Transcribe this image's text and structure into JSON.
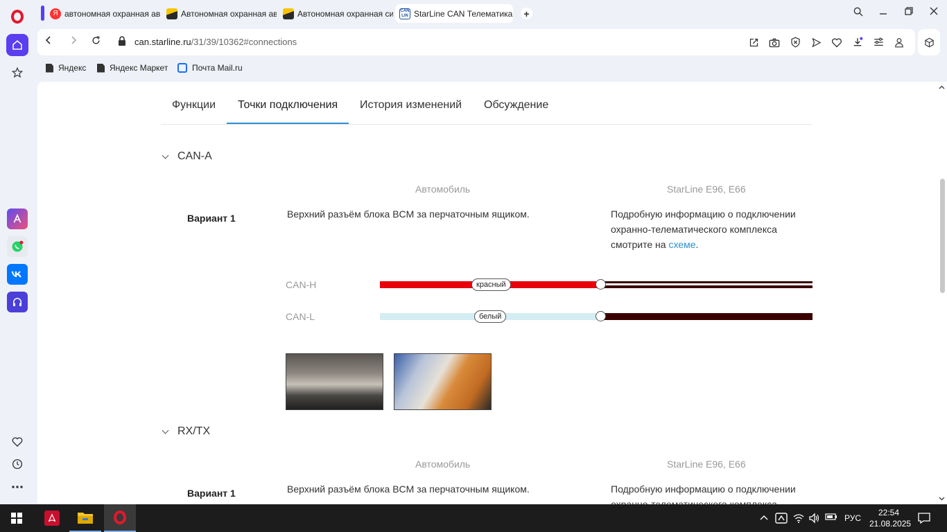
{
  "browser": {
    "tabs": [
      {
        "title": "автономная охранная ав",
        "favicon": "yandex-icon"
      },
      {
        "title": "Автономная охранная ав",
        "favicon": "image-icon"
      },
      {
        "title": "Автономная охранная си",
        "favicon": "image-icon"
      },
      {
        "title": "StarLine CAN Телематика",
        "favicon": "starline-can-icon",
        "active": true
      }
    ],
    "new_tab": "+",
    "address": {
      "domain": "can.starline.ru",
      "path": "/31/39/10362#connections"
    },
    "bookmarks": [
      {
        "label": "Яндекс"
      },
      {
        "label": "Яндекс Маркет"
      },
      {
        "label": "Почта Mail.ru"
      }
    ]
  },
  "page": {
    "tabs": [
      {
        "label": "Функции"
      },
      {
        "label": "Точки подключения",
        "active": true
      },
      {
        "label": "История изменений"
      },
      {
        "label": "Обсуждение"
      }
    ],
    "sections": [
      {
        "title": "CAN-A",
        "col_car": "Автомобиль",
        "col_device": "StarLine E96, E66",
        "variant": "Вариант 1",
        "description": "Верхний разъём блока BCM за перчаточным ящиком.",
        "info_text": "Подробную информацию о подключении охранно-телематического комплекса смотрите на",
        "info_link": "схеме",
        "info_end": ".",
        "wires": [
          {
            "name": "CAN-H",
            "color_label": "красный",
            "car_color": "#e8000b",
            "device_color": "#3a0000"
          },
          {
            "name": "CAN-L",
            "color_label": "белый",
            "car_color": "#d4edf2",
            "device_color": "#3a0000"
          }
        ]
      },
      {
        "title": "RX/TX",
        "col_car": "Автомобиль",
        "col_device": "StarLine E96, E66",
        "variant": "Вариант 1",
        "description": "Верхний разъём блока BCM за перчаточным ящиком.",
        "info_text": "Подробную информацию о подключении",
        "info_text2": "охранно-телематического комплекса"
      }
    ]
  },
  "taskbar": {
    "lang": "РУС",
    "time": "22:54",
    "date": "21.08.2025"
  }
}
